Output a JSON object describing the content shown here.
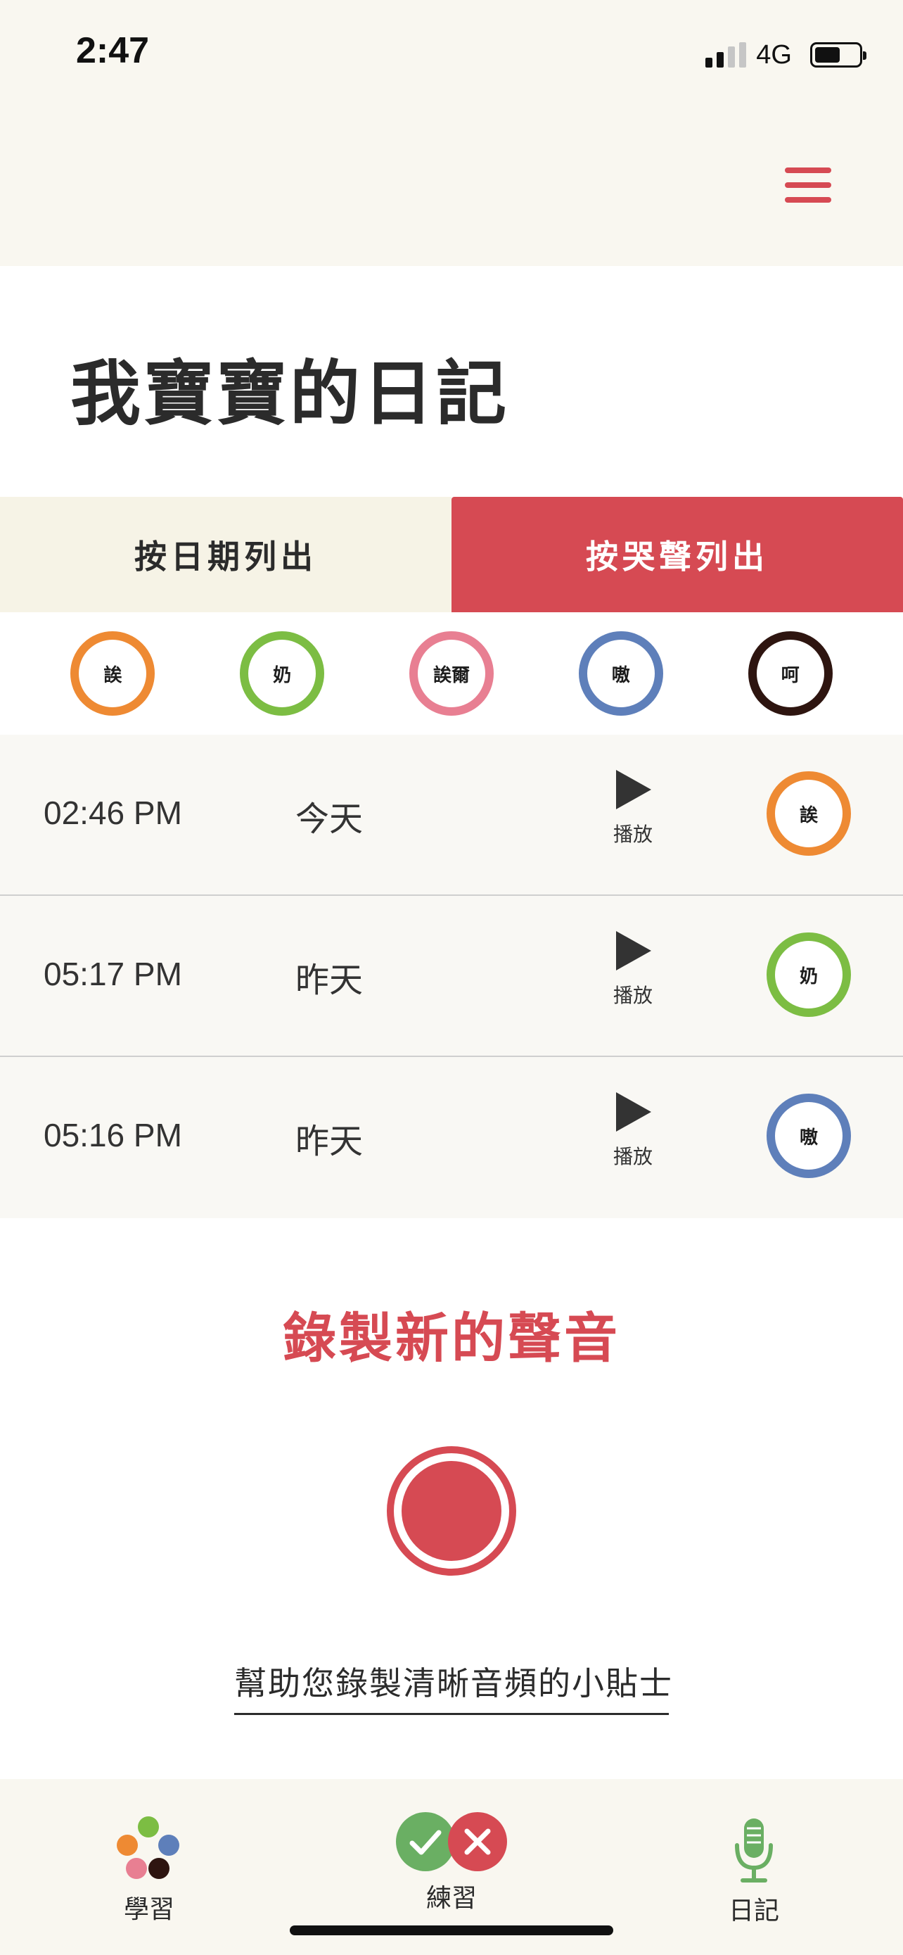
{
  "status_bar": {
    "time": "2:47",
    "network": "4G"
  },
  "page": {
    "title": "我寶寶的日記"
  },
  "tabs": [
    {
      "label": "按日期列出",
      "active": false
    },
    {
      "label": "按哭聲列出",
      "active": true
    }
  ],
  "filters": [
    {
      "label": "誒",
      "color": "#ee8a33"
    },
    {
      "label": "奶",
      "color": "#7cbd43"
    },
    {
      "label": "誒爾",
      "color": "#e87f92"
    },
    {
      "label": "嗷",
      "color": "#5e7fba"
    },
    {
      "label": "呵",
      "color": "#2e1510"
    }
  ],
  "recordings": [
    {
      "time": "02:46 PM",
      "day": "今天",
      "play_label": "播放",
      "type": "誒",
      "color": "#ee8a33"
    },
    {
      "time": "05:17 PM",
      "day": "昨天",
      "play_label": "播放",
      "type": "奶",
      "color": "#7cbd43"
    },
    {
      "time": "05:16 PM",
      "day": "昨天",
      "play_label": "播放",
      "type": "嗷",
      "color": "#5e7fba"
    }
  ],
  "record": {
    "title": "錄製新的聲音",
    "tips_link": "幫助您錄製清晰音頻的小貼士"
  },
  "nav": [
    {
      "label": "學習",
      "icon": "colored-dots-icon"
    },
    {
      "label": "練習",
      "icon": "check-cross-icon"
    },
    {
      "label": "日記",
      "icon": "microphone-icon"
    }
  ],
  "colors": {
    "accent": "#d64a53",
    "header_bg": "#f9f7f0",
    "check_green": "#6aaf63",
    "cross_red": "#d64a53",
    "mic_green": "#6aaf63"
  }
}
